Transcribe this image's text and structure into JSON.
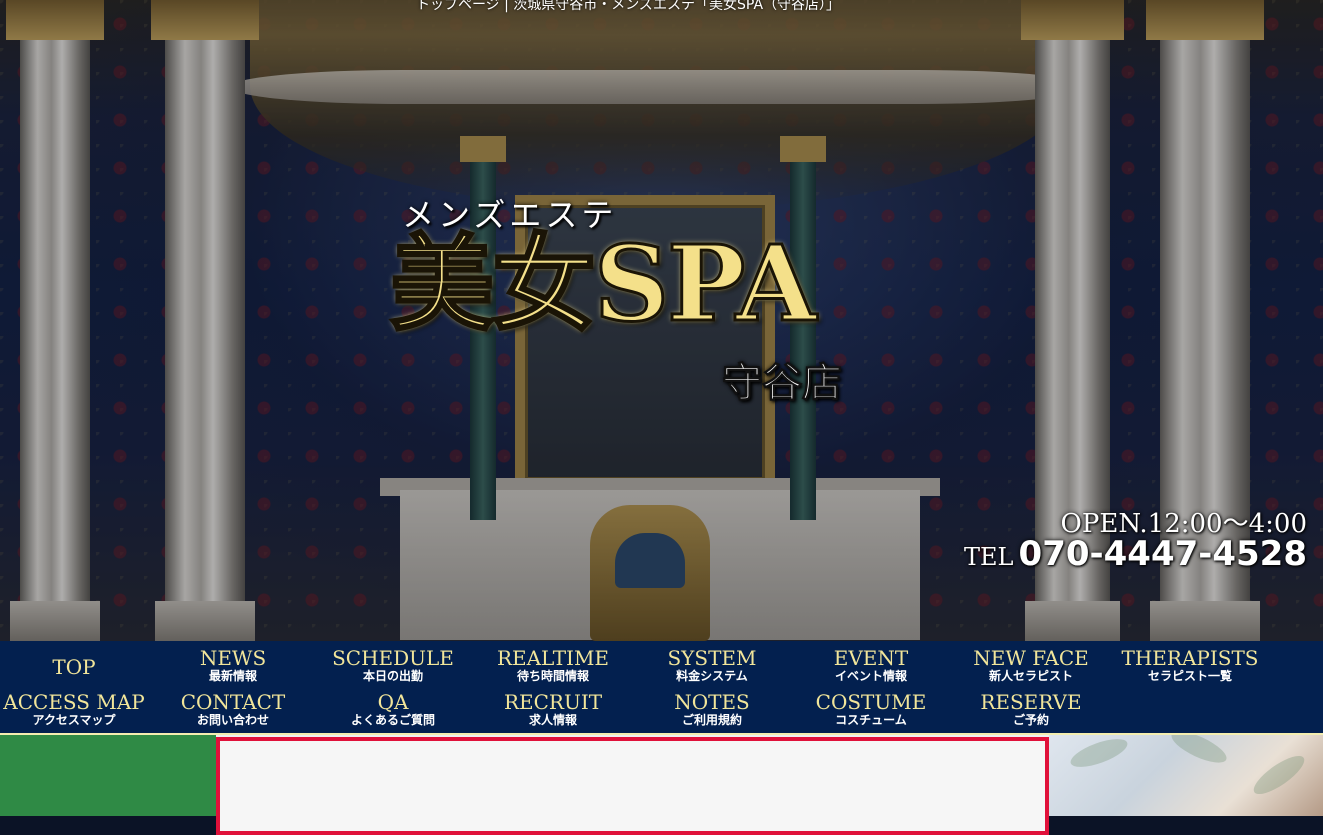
{
  "breadcrumb": "トップページ | 茨城県守谷市・メンズエステ「美女SPA（守谷店）」",
  "logo": {
    "tagline": "メンズエステ",
    "name": "美女SPA",
    "branch": "守谷店"
  },
  "hours": "OPEN.12:00〜4:00",
  "tel": {
    "label": "TEL",
    "number": "070-4447-4528"
  },
  "nav": {
    "row1": [
      {
        "en": "TOP",
        "jp": ""
      },
      {
        "en": "NEWS",
        "jp": "最新情報"
      },
      {
        "en": "SCHEDULE",
        "jp": "本日の出勤"
      },
      {
        "en": "REALTIME",
        "jp": "待ち時間情報"
      },
      {
        "en": "SYSTEM",
        "jp": "料金システム"
      },
      {
        "en": "EVENT",
        "jp": "イベント情報"
      },
      {
        "en": "NEW FACE",
        "jp": "新人セラピスト"
      },
      {
        "en": "THERAPISTS",
        "jp": "セラピスト一覧"
      }
    ],
    "row2": [
      {
        "en": "ACCESS MAP",
        "jp": "アクセスマップ"
      },
      {
        "en": "CONTACT",
        "jp": "お問い合わせ"
      },
      {
        "en": "QA",
        "jp": "よくあるご質問"
      },
      {
        "en": "RECRUIT",
        "jp": "求人情報"
      },
      {
        "en": "NOTES",
        "jp": "ご利用規約"
      },
      {
        "en": "COSTUME",
        "jp": "コスチューム"
      },
      {
        "en": "RESERVE",
        "jp": "ご予約"
      }
    ]
  },
  "colors": {
    "nav_bg": "#03204f",
    "nav_text": "#f1e59a",
    "accent_red": "#e0113a",
    "side_green": "#2f8a45"
  }
}
